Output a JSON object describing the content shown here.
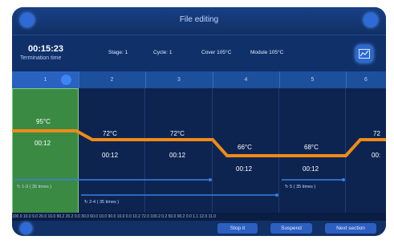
{
  "title": "File editing",
  "run": {
    "elapsed": "00:15:23",
    "elapsed_label": "Termination time",
    "stage": "Stage:  1",
    "cycle": "Cycle:  1",
    "cover": "Cover 105°C",
    "module": "Module 105°C"
  },
  "steps": [
    {
      "number": "1",
      "temp": "95°C",
      "time": "00:12"
    },
    {
      "number": "2",
      "temp": "72°C",
      "time": "00:12"
    },
    {
      "number": "3",
      "temp": "72°C",
      "time": "00:12"
    },
    {
      "number": "4",
      "temp": "66°C",
      "time": "00:12"
    },
    {
      "number": "5",
      "temp": "68°C",
      "time": "00:12"
    },
    {
      "number": "6",
      "temp": "72",
      "time": "00:"
    }
  ],
  "cycles": [
    {
      "label": "1-3 ( 35 times )"
    },
    {
      "label": "2-4 ( 35 times )"
    },
    {
      "label": "5 ( 35 times )"
    }
  ],
  "ruler": "100.0  10.0   9.0   20.0   10.0  90.2  20.2   0.0   30.0  60.0   10.0  90.0   10.0   0.0   10.2  72.0  100.2  0.2   50.0  90.2   0.0   1.1   12.0  11.0",
  "buttons": {
    "stop": "Stop it",
    "suspend": "Suspend",
    "next": "Next section"
  },
  "colors": {
    "profile_line": "#f08a17",
    "active_step": "#3a8a44",
    "background": "#0e2a5c"
  }
}
